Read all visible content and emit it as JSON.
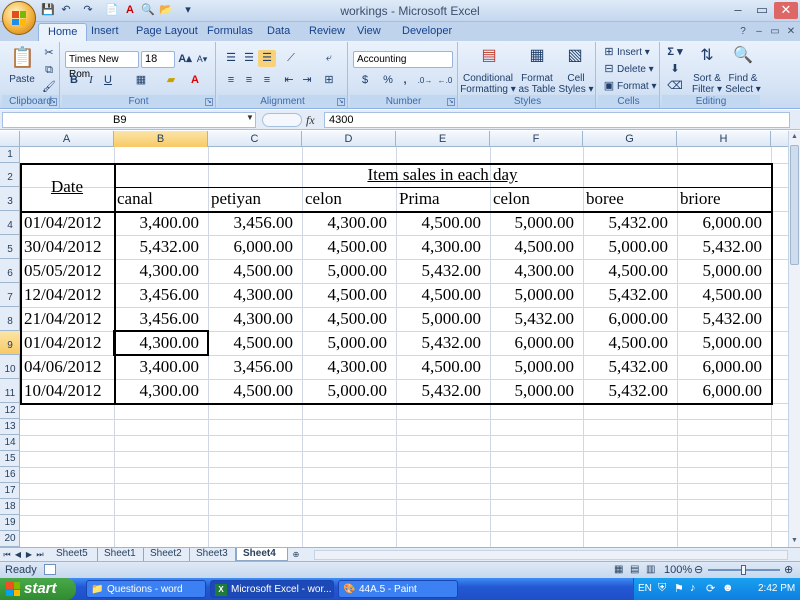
{
  "window": {
    "title": "workings - Microsoft Excel",
    "min": "–",
    "max": "▭",
    "close": "✕"
  },
  "quick_access": [
    "💾",
    "↶",
    "↷",
    "📄",
    "A",
    "🔍",
    "📂",
    "▾"
  ],
  "tabs": [
    "Home",
    "Insert",
    "Page Layout",
    "Formulas",
    "Data",
    "Review",
    "View",
    "Developer"
  ],
  "ribbon": {
    "clipboard": {
      "label": "Clipboard",
      "paste": "Paste"
    },
    "font": {
      "label": "Font",
      "name": "Times New Rom",
      "size": "18",
      "bold": "B",
      "italic": "I",
      "underline": "U",
      "grow": "A▴",
      "shrink": "A▾"
    },
    "alignment": {
      "label": "Alignment"
    },
    "number": {
      "label": "Number",
      "format": "Accounting",
      "currency": "$",
      "percent": "%",
      "comma": ","
    },
    "styles": {
      "label": "Styles",
      "cond1": "Conditional",
      "cond2": "Formatting ▾",
      "table1": "Format",
      "table2": "as Table ▾",
      "cell1": "Cell",
      "cell2": "Styles ▾"
    },
    "cells": {
      "label": "Cells",
      "insert": "Insert ▾",
      "delete": "Delete ▾",
      "format": "Format ▾"
    },
    "editing": {
      "label": "Editing",
      "sum": "Σ ▾",
      "sort1": "Sort &",
      "sort2": "Filter ▾",
      "find1": "Find &",
      "find2": "Select ▾"
    }
  },
  "formula_bar": {
    "name_box": "B9",
    "fx": "fx",
    "formula": "4300"
  },
  "columns": [
    "A",
    "B",
    "C",
    "D",
    "E",
    "F",
    "G",
    "H"
  ],
  "rows": [
    "1",
    "2",
    "3",
    "4",
    "5",
    "6",
    "7",
    "8",
    "9",
    "10",
    "11",
    "12",
    "13",
    "14",
    "15",
    "16",
    "17",
    "18",
    "19",
    "20"
  ],
  "sheet": {
    "title": "Item sales in each day",
    "date_header": "Date",
    "item_headers": [
      "canal",
      "petiyan",
      "celon",
      "Prima",
      "celon",
      "boree",
      "briore"
    ],
    "data": [
      [
        "01/04/2012",
        "3,400.00",
        "3,456.00",
        "4,300.00",
        "4,500.00",
        "5,000.00",
        "5,432.00",
        "6,000.00"
      ],
      [
        "30/04/2012",
        "5,432.00",
        "6,000.00",
        "4,500.00",
        "4,300.00",
        "4,500.00",
        "5,000.00",
        "5,432.00"
      ],
      [
        "05/05/2012",
        "4,300.00",
        "4,500.00",
        "5,000.00",
        "5,432.00",
        "4,300.00",
        "4,500.00",
        "5,000.00"
      ],
      [
        "12/04/2012",
        "3,456.00",
        "4,300.00",
        "4,500.00",
        "4,500.00",
        "5,000.00",
        "5,432.00",
        "4,500.00"
      ],
      [
        "21/04/2012",
        "3,456.00",
        "4,300.00",
        "4,500.00",
        "5,000.00",
        "5,432.00",
        "6,000.00",
        "5,432.00"
      ],
      [
        "01/04/2012",
        "4,300.00",
        "4,500.00",
        "5,000.00",
        "5,432.00",
        "6,000.00",
        "4,500.00",
        "5,000.00"
      ],
      [
        "04/06/2012",
        "3,400.00",
        "3,456.00",
        "4,300.00",
        "4,500.00",
        "5,000.00",
        "5,432.00",
        "6,000.00"
      ],
      [
        "10/04/2012",
        "4,300.00",
        "4,500.00",
        "5,000.00",
        "5,432.00",
        "5,000.00",
        "5,432.00",
        "6,000.00"
      ]
    ]
  },
  "sheet_tabs": [
    "Sheet5",
    "Sheet1",
    "Sheet2",
    "Sheet3",
    "Sheet4"
  ],
  "active_sheet": "Sheet4",
  "status": {
    "ready": "Ready",
    "zoom": "100%"
  },
  "taskbar": {
    "start": "start",
    "tasks": [
      "Questions - word",
      "Microsoft Excel - wor...",
      "44A.5 - Paint"
    ],
    "lang": "EN",
    "time": "2:42 PM"
  }
}
